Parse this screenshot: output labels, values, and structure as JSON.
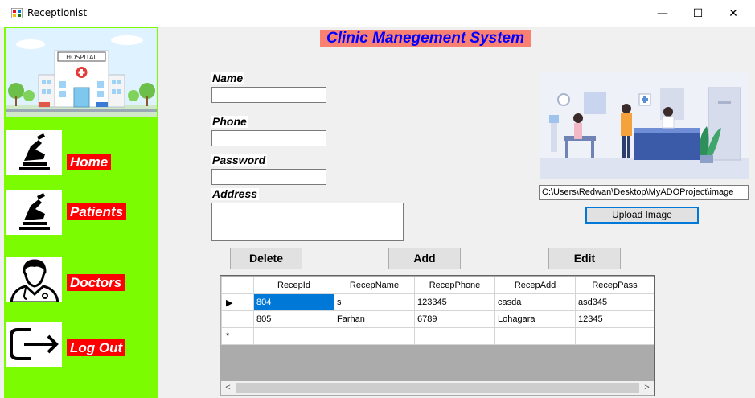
{
  "window": {
    "title": "Receptionist",
    "minimize_glyph": "—",
    "maximize_glyph": "☐",
    "close_glyph": "✕"
  },
  "sidebar": {
    "items": [
      {
        "label": "Home",
        "icon": "dental-chair-icon"
      },
      {
        "label": "Patients",
        "icon": "dental-chair-icon"
      },
      {
        "label": "Doctors",
        "icon": "doctor-icon"
      },
      {
        "label": "Log Out",
        "icon": "logout-icon"
      }
    ],
    "hospital_sign": "HOSPITAL"
  },
  "header": {
    "title": "Clinic Manegement System"
  },
  "form": {
    "name_label": "Name",
    "phone_label": "Phone",
    "password_label": "Password",
    "address_label": "Address",
    "name_value": "",
    "phone_value": "",
    "password_value": "",
    "address_value": ""
  },
  "buttons": {
    "delete": "Delete",
    "add": "Add",
    "edit": "Edit"
  },
  "image_panel": {
    "path": "C:\\Users\\Redwan\\Desktop\\MyADOProject\\image",
    "upload_label": "Upload Image"
  },
  "grid": {
    "columns": [
      "RecepId",
      "RecepName",
      "RecepPhone",
      "RecepAdd",
      "RecepPass"
    ],
    "rows": [
      [
        "804",
        "s",
        "123345",
        "casda",
        "asd345"
      ],
      [
        "805",
        "Farhan",
        "6789",
        "Lohagara",
        "12345"
      ]
    ],
    "current_row_marker": "▶",
    "new_row_marker": "*"
  },
  "colors": {
    "sidebar_bg": "#7cfc00",
    "label_bg": "#ff0000",
    "title_bg": "#fa8072",
    "title_fg": "#0000ff",
    "selection": "#0078d7"
  }
}
